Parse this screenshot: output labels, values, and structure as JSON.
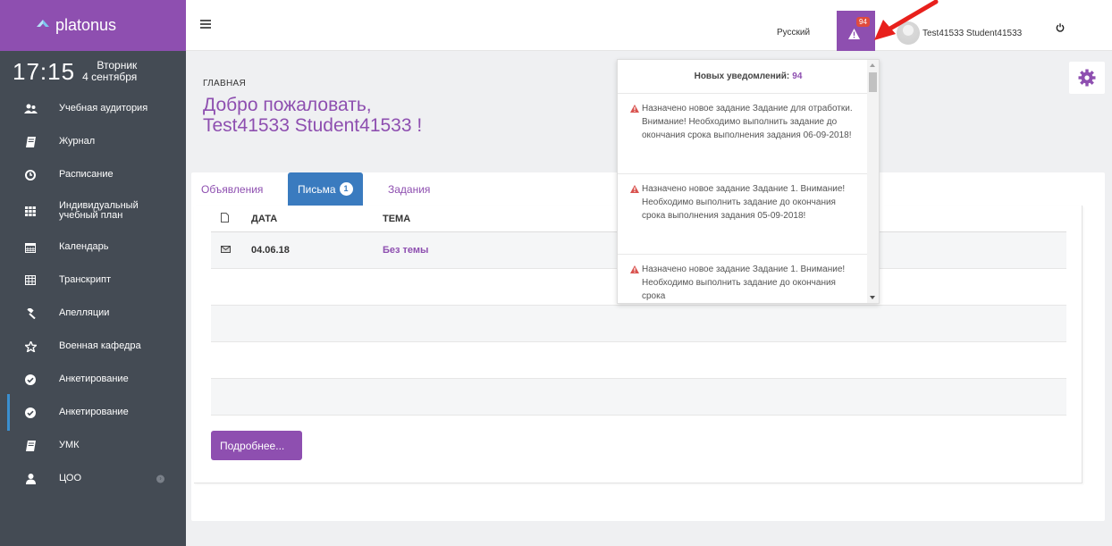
{
  "brand": {
    "name": "platonus"
  },
  "clock": {
    "time": "17:15",
    "weekday": "Вторник",
    "date": "4 сентября"
  },
  "sidebar": {
    "items": [
      {
        "label": "Учебная аудитория",
        "icon": "users-icon"
      },
      {
        "label": "Журнал",
        "icon": "book-icon"
      },
      {
        "label": "Расписание",
        "icon": "clock-icon"
      },
      {
        "label": "Индивидуальный учебный план",
        "icon": "grid-icon"
      },
      {
        "label": "Календарь",
        "icon": "calendar-icon"
      },
      {
        "label": "Транскрипт",
        "icon": "table-icon"
      },
      {
        "label": "Апелляции",
        "icon": "gavel-icon"
      },
      {
        "label": "Военная кафедра",
        "icon": "star-icon"
      },
      {
        "label": "Анкетирование",
        "icon": "check-circle-icon"
      },
      {
        "label": "Анкетирование",
        "icon": "check-circle-icon"
      },
      {
        "label": "УМК",
        "icon": "book-icon"
      },
      {
        "label": "ЦОО",
        "icon": "user-icon"
      }
    ]
  },
  "header": {
    "language": "Русский",
    "notifications_badge": "94",
    "user_name": "Test41533 Student41533"
  },
  "main": {
    "breadcrumb": "ГЛАВНАЯ",
    "welcome_line1": "Добро пожаловать,",
    "welcome_line2": "Test41533 Student41533 !",
    "tabs": [
      {
        "label": "Объявления"
      },
      {
        "label": "Письма",
        "badge": "1"
      },
      {
        "label": "Задания"
      }
    ],
    "table": {
      "headers": {
        "date": "ДАТА",
        "topic": "ТЕМА"
      },
      "rows": [
        {
          "date": "04.06.18",
          "topic": "Без темы"
        }
      ]
    },
    "more_button": "Подробнее..."
  },
  "notifications": {
    "header_label": "Новых уведомлений:",
    "count": "94",
    "items": [
      {
        "text": "Назначено новое задание Задание для отработки. Внимание! Необходимо выполнить задание до окончания срока выполнения задания 06-09-2018!"
      },
      {
        "text": "Назначено новое задание Задание 1. Внимание! Необходимо выполнить задание до окончания срока выполнения задания 05-09-2018!"
      },
      {
        "text": "Назначено новое задание Задание 1. Внимание! Необходимо выполнить задание до окончания срока"
      }
    ]
  },
  "colors": {
    "brand": "#8e4fb0",
    "sidebar": "#444b54",
    "tab_active": "#3a7bbf",
    "badge": "#e04b3d",
    "annotation_arrow": "#e8201c"
  }
}
